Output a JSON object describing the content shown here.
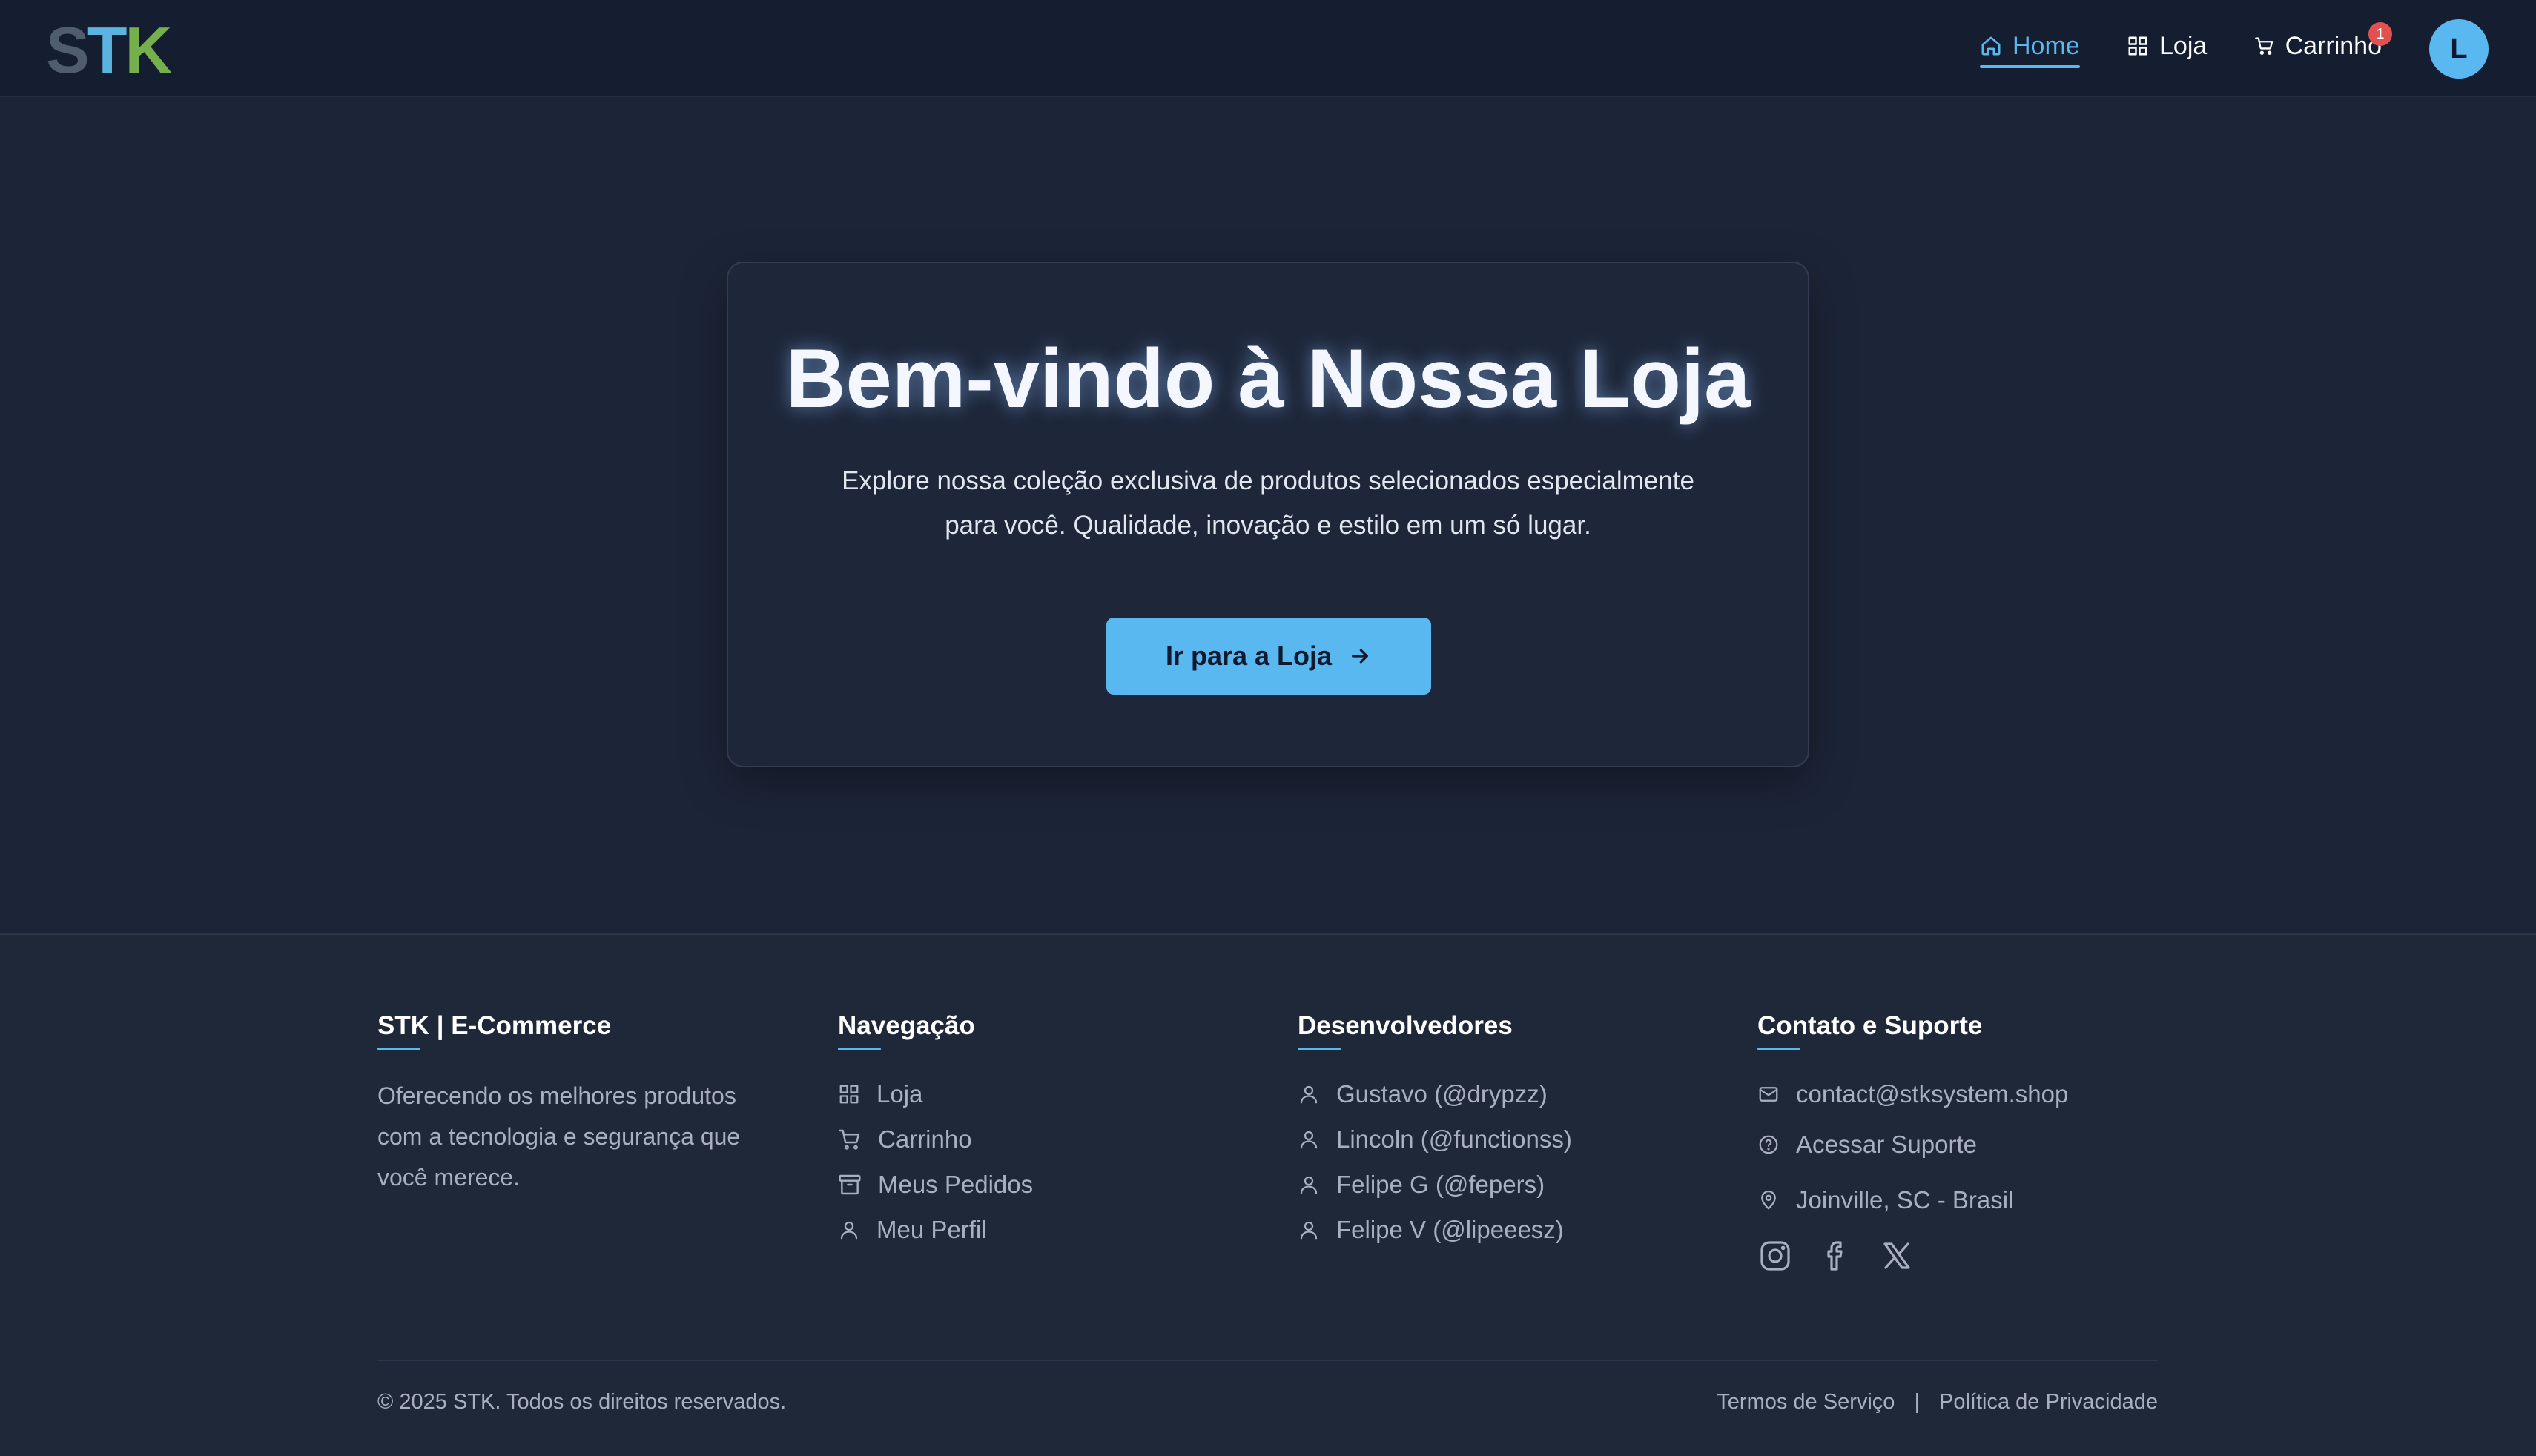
{
  "header": {
    "logo": {
      "s": "S",
      "t": "T",
      "k": "K"
    },
    "nav": {
      "home": "Home",
      "loja": "Loja",
      "carrinho": "Carrinho"
    },
    "cart_count": "1",
    "avatar_initial": "L"
  },
  "hero": {
    "title": "Bem-vindo à Nossa Loja",
    "description_line1": "Explore nossa coleção exclusiva de produtos selecionados especialmente",
    "description_line2": "para você. Qualidade, inovação e estilo em um só lugar.",
    "button_label": "Ir para a Loja"
  },
  "footer": {
    "about": {
      "title": "STK | E-Commerce",
      "text_line1": "Oferecendo os melhores produtos",
      "text_line2": "com a tecnologia e segurança que",
      "text_line3": "você merece."
    },
    "navigation": {
      "title": "Navegação",
      "items": [
        "Loja",
        "Carrinho",
        "Meus Pedidos",
        "Meu Perfil"
      ]
    },
    "developers": {
      "title": "Desenvolvedores",
      "items": [
        "Gustavo (@drypzz)",
        "Lincoln (@functionss)",
        "Felipe G (@fepers)",
        "Felipe V (@lipeeesz)"
      ]
    },
    "contact": {
      "title": "Contato e Suporte",
      "email": "contact@stksystem.shop",
      "support": "Acessar Suporte",
      "location": "Joinville, SC - Brasil"
    },
    "copyright": "© 2025 STK. Todos os direitos reservados.",
    "terms": "Termos de Serviço",
    "separator": "|",
    "privacy": "Política de Privacidade"
  },
  "colors": {
    "accent": "#5ab8f0",
    "background": "#1c2538",
    "header": "#151d30",
    "footer": "#1f2839",
    "badge": "#e05252",
    "logo_green": "#76b04d"
  },
  "icons": {
    "nav_home": "home-icon",
    "nav_loja": "grid-icon",
    "nav_cart": "cart-icon",
    "hero_button": "arrow-right-icon",
    "footer_nav": [
      "grid-icon",
      "cart-icon",
      "archive-icon",
      "user-icon"
    ],
    "footer_dev": "user-icon",
    "contact": [
      "mail-icon",
      "help-circle-icon",
      "map-pin-icon"
    ],
    "socials": [
      "instagram-icon",
      "facebook-icon",
      "x-icon"
    ]
  }
}
